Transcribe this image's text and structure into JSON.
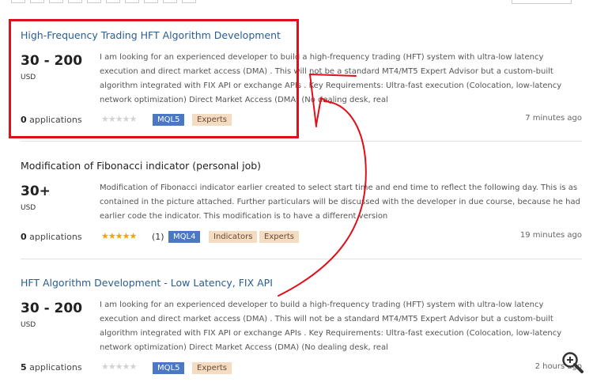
{
  "jobs": [
    {
      "title": "High-Frequency Trading HFT Algorithm Development",
      "price": "30 - 200",
      "currency": "USD",
      "description": "I am looking for an experienced developer to build a high-frequency trading (HFT) system with ultra-low latency execution and direct market access (DMA) . This will not be a standard MT4/MT5 Expert Advisor but a custom-built algorithm integrated with FIX API or exchange APIs . Key Requirements: Ultra-fast execution (Colocation, low-latency network optimization) Direct Market Access (DMA) (No dealing desk, real",
      "applications_count": "0",
      "applications_label": "applications",
      "rating_stars": 0,
      "tags": [
        "MQL5",
        "Experts"
      ],
      "time": "7 minutes ago"
    },
    {
      "title": "Modification of Fibonacci indicator (personal job)",
      "price": "30+",
      "currency": "USD",
      "description": "Modification of Fibonacci indicator earlier created to select start time and end time to reflect the following day. This is as contained in the picture attached. Further particulars will be discussed with the developer in due course, because he had earlier code the indicator. This modification is to have a different version",
      "applications_count": "0",
      "applications_label": "applications",
      "rating_stars": 5,
      "rating_count": "(1)",
      "tags": [
        "MQL4",
        "Indicators",
        "Experts"
      ],
      "time": "19 minutes ago"
    },
    {
      "title": "HFT Algorithm Development - Low Latency, FIX API",
      "price": "30 - 200",
      "currency": "USD",
      "description": "I am looking for an experienced developer to build a high-frequency trading (HFT) system with ultra-low latency execution and direct market access (DMA) . This will not be a standard MT4/MT5 Expert Advisor but a custom-built algorithm integrated with FIX API or exchange APIs . Key Requirements: Ultra-fast execution (Colocation, low-latency network optimization) Direct Market Access (DMA) (No dealing desk, real",
      "applications_count": "5",
      "applications_label": "applications",
      "rating_stars": 0,
      "tags": [
        "MQL5",
        "Experts"
      ],
      "time": "2 hours ago"
    }
  ],
  "icons": {
    "star": "star-icon",
    "zoom": "zoom-in-icon"
  },
  "colors": {
    "highlight": "#e0101a",
    "link": "#2a5d8f",
    "mql_tag": "#4a78c2",
    "category_tag": "#f4dcc2",
    "star_gold": "#f0a500"
  }
}
